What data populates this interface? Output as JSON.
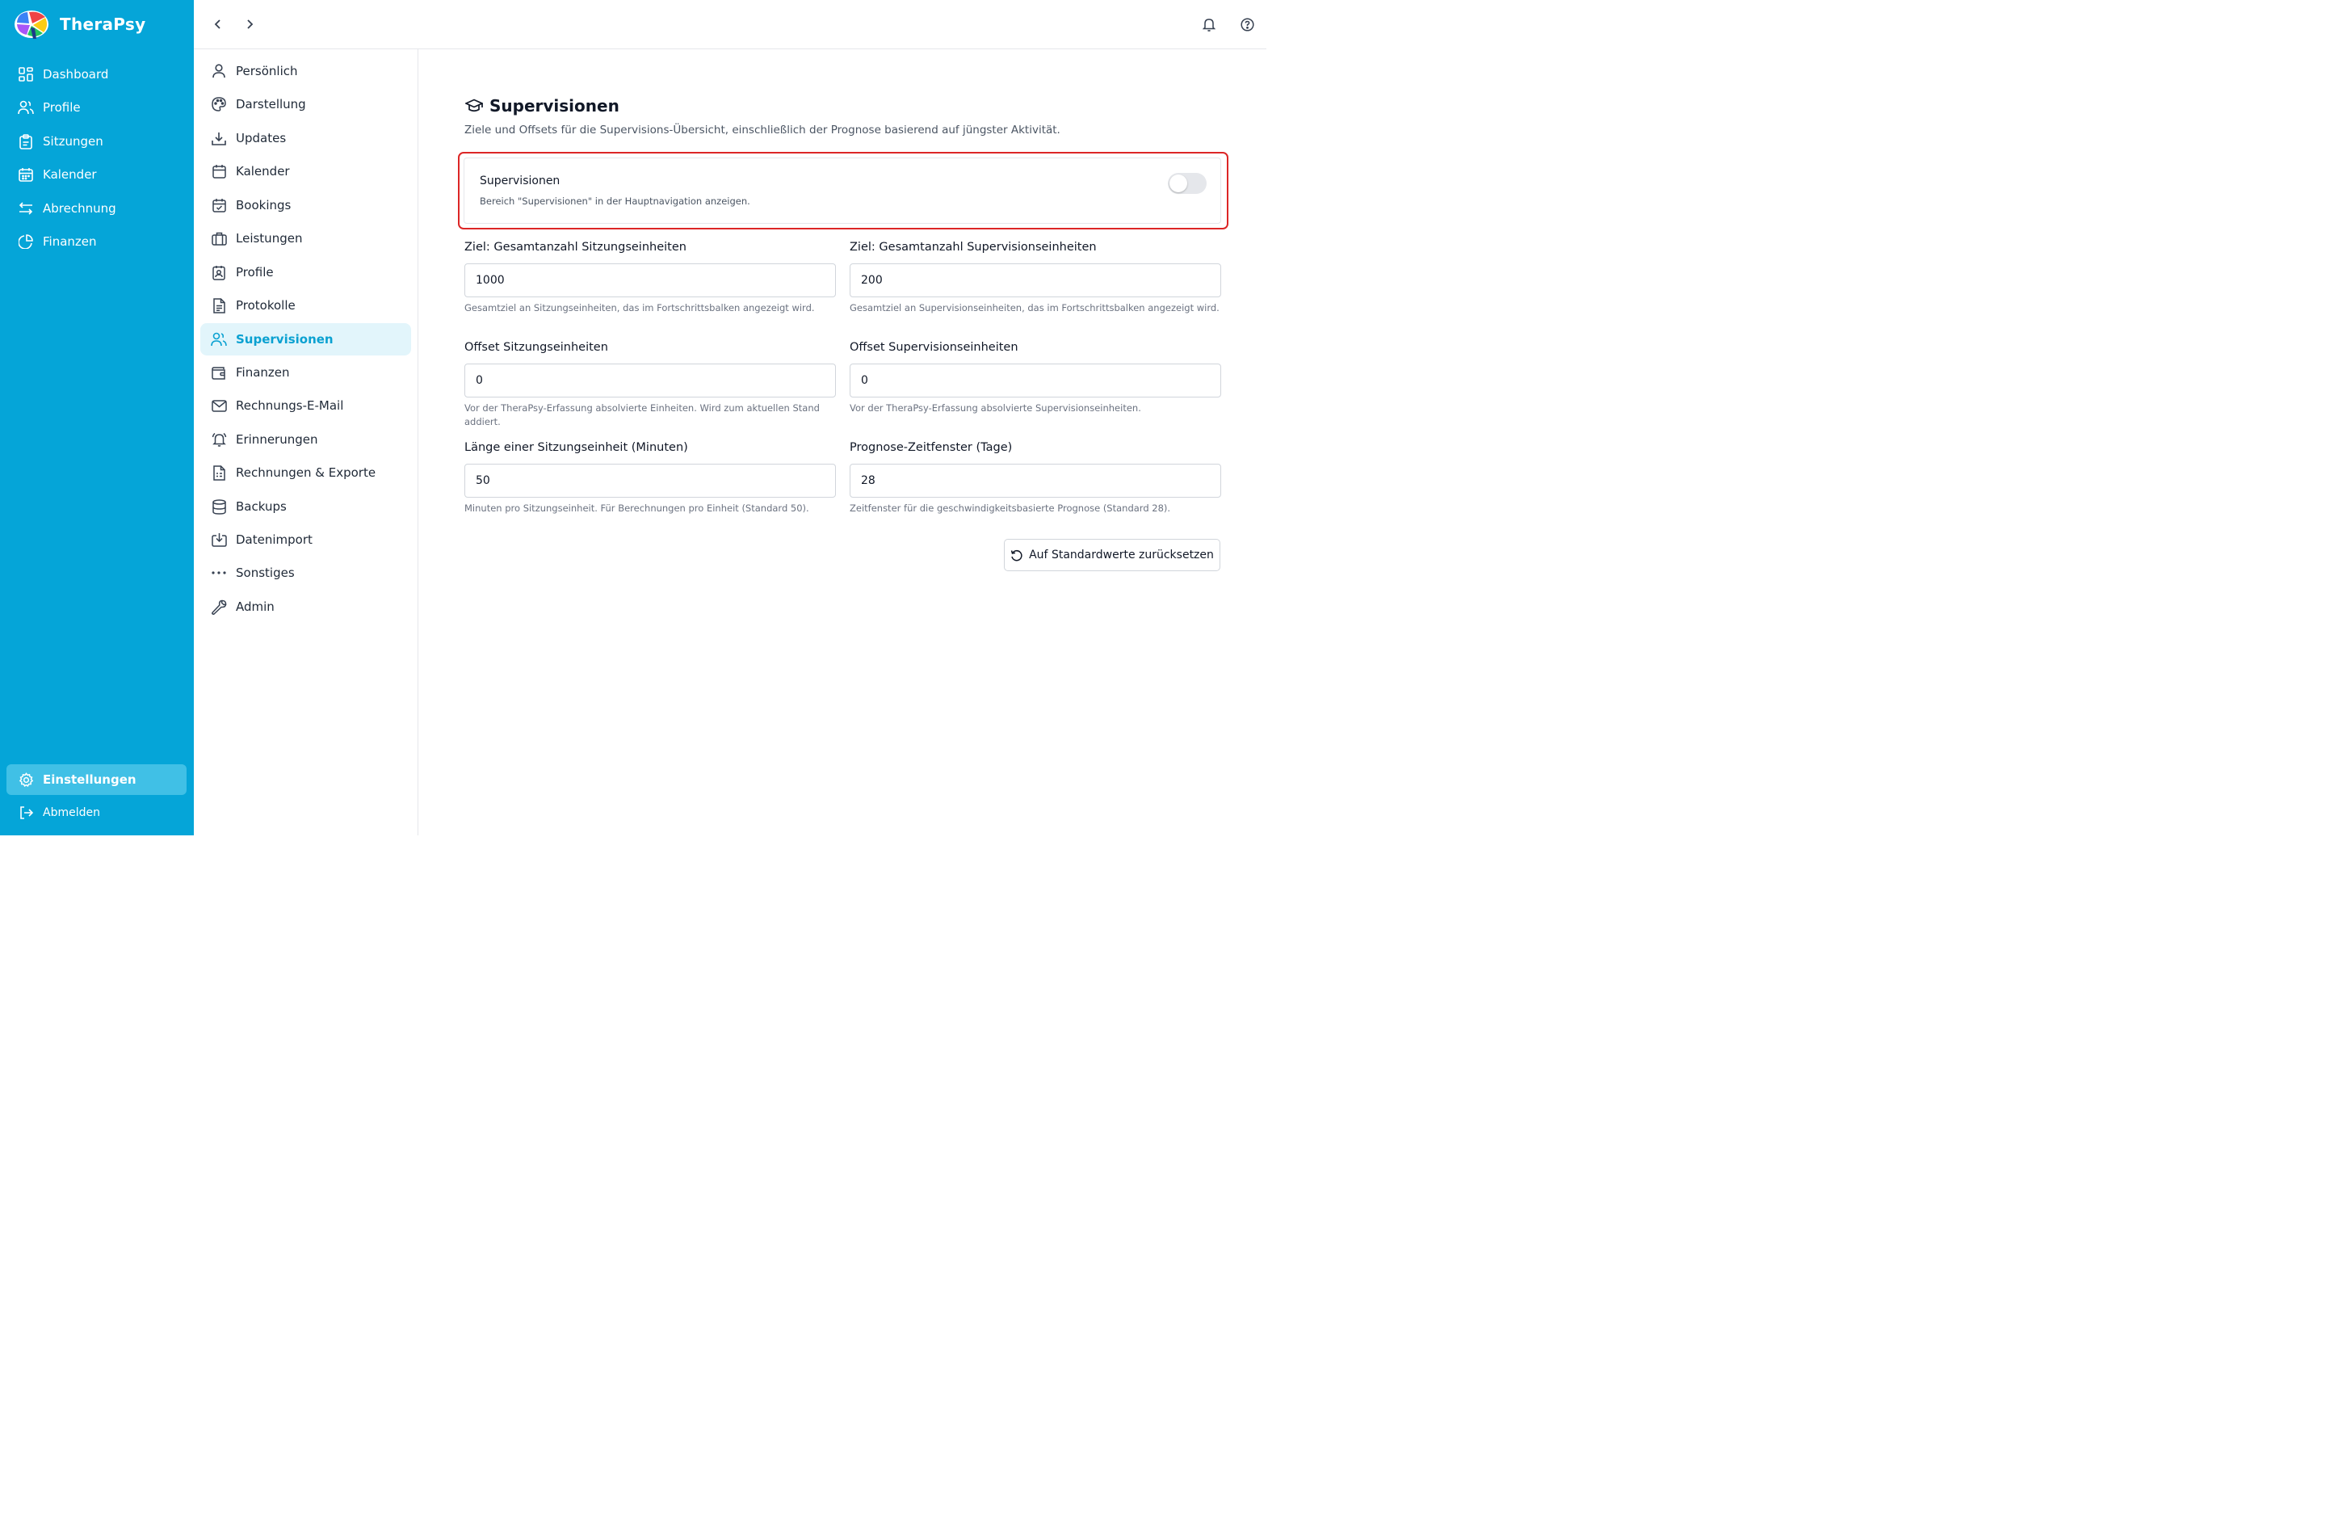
{
  "app": {
    "name": "TheraPsy",
    "nav": [
      {
        "label": "Dashboard",
        "icon": "dashboard-icon"
      },
      {
        "label": "Profile",
        "icon": "users-icon"
      },
      {
        "label": "Sitzungen",
        "icon": "clipboard-icon"
      },
      {
        "label": "Kalender",
        "icon": "calendar-icon"
      },
      {
        "label": "Abrechnung",
        "icon": "arrows-exchange-icon"
      },
      {
        "label": "Finanzen",
        "icon": "pie-chart-icon"
      }
    ],
    "settings_label": "Einstellungen",
    "logout_label": "Abmelden"
  },
  "settings_menu": [
    {
      "label": "Persönlich",
      "icon": "user-icon"
    },
    {
      "label": "Darstellung",
      "icon": "palette-icon"
    },
    {
      "label": "Updates",
      "icon": "download-icon"
    },
    {
      "label": "Kalender",
      "icon": "calendar-icon"
    },
    {
      "label": "Bookings",
      "icon": "calendar-check-icon"
    },
    {
      "label": "Leistungen",
      "icon": "briefcase-icon"
    },
    {
      "label": "Profile",
      "icon": "contact-icon"
    },
    {
      "label": "Protokolle",
      "icon": "document-icon"
    },
    {
      "label": "Supervisionen",
      "icon": "users-icon",
      "active": true
    },
    {
      "label": "Finanzen",
      "icon": "wallet-icon"
    },
    {
      "label": "Rechnungs-E-Mail",
      "icon": "mail-icon"
    },
    {
      "label": "Erinnerungen",
      "icon": "bell-ring-icon"
    },
    {
      "label": "Rechnungen & Exporte",
      "icon": "invoice-icon"
    },
    {
      "label": "Backups",
      "icon": "database-icon"
    },
    {
      "label": "Datenimport",
      "icon": "import-icon"
    },
    {
      "label": "Sonstiges",
      "icon": "more-icon"
    },
    {
      "label": "Admin",
      "icon": "wrench-icon"
    }
  ],
  "page": {
    "title": "Supervisionen",
    "description": "Ziele und Offsets für die Supervisions-Übersicht, einschließlich der Prognose basierend auf jüngster Aktivität.",
    "toggle": {
      "label": "Supervisionen",
      "help": "Bereich \"Supervisionen\" in der Hauptnavigation anzeigen.",
      "enabled": false
    },
    "fields": {
      "target_sessions": {
        "label": "Ziel: Gesamtanzahl Sitzungseinheiten",
        "value": "1000",
        "help": "Gesamtziel an Sitzungseinheiten, das im Fortschrittsbalken angezeigt wird."
      },
      "target_supervision": {
        "label": "Ziel: Gesamtanzahl Supervisionseinheiten",
        "value": "200",
        "help": "Gesamtziel an Supervisionseinheiten, das im Fortschrittsbalken angezeigt wird."
      },
      "offset_sessions": {
        "label": "Offset Sitzungseinheiten",
        "value": "0",
        "help": "Vor der TheraPsy-Erfassung absolvierte Einheiten. Wird zum aktuellen Stand addiert."
      },
      "offset_supervision": {
        "label": "Offset Supervisionseinheiten",
        "value": "0",
        "help": "Vor der TheraPsy-Erfassung absolvierte Supervisionseinheiten."
      },
      "session_length": {
        "label": "Länge einer Sitzungseinheit (Minuten)",
        "value": "50",
        "help": "Minuten pro Sitzungseinheit. Für Berechnungen pro Einheit (Standard 50)."
      },
      "forecast_window": {
        "label": "Prognose-Zeitfenster (Tage)",
        "value": "28",
        "help": "Zeitfenster für die geschwindigkeitsbasierte Prognose (Standard 28)."
      }
    },
    "reset_label": "Auf Standardwerte zurücksetzen"
  },
  "colors": {
    "sidebar": "#05a5d8",
    "accent": "#0aa1d1",
    "highlight": "#dc2626"
  }
}
